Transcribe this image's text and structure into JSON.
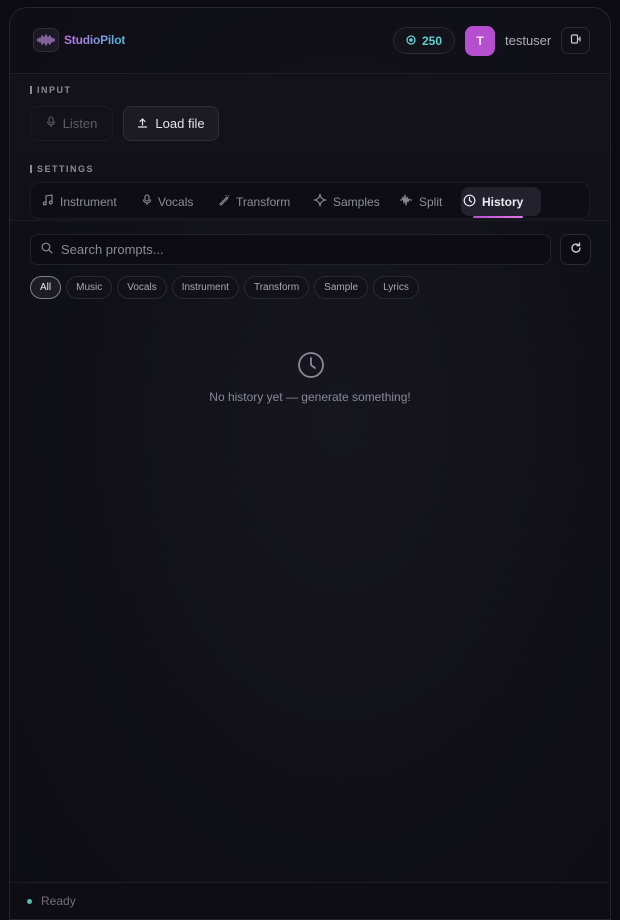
{
  "header": {
    "brand": "StudioPilot",
    "credits": "250",
    "avatar_initial": "T",
    "username": "testuser"
  },
  "input_section": {
    "label": "INPUT",
    "listen_label": "Listen",
    "load_file_label": "Load file"
  },
  "settings_section": {
    "label": "SETTINGS",
    "tabs": [
      {
        "label": "Instrument",
        "icon": "music-note-icon"
      },
      {
        "label": "Vocals",
        "icon": "microphone-icon"
      },
      {
        "label": "Transform",
        "icon": "wand-icon"
      },
      {
        "label": "Samples",
        "icon": "sparkle-icon"
      },
      {
        "label": "Split",
        "icon": "waveform-icon"
      },
      {
        "label": "History",
        "icon": "clock-icon",
        "active": true
      }
    ]
  },
  "history": {
    "search_placeholder": "Search prompts...",
    "filters": [
      "All",
      "Music",
      "Vocals",
      "Instrument",
      "Transform",
      "Sample",
      "Lyrics"
    ],
    "active_filter": "All",
    "empty_message": "No history yet — generate something!"
  },
  "status": {
    "text": "Ready",
    "color": "#4fc0b0"
  },
  "colors": {
    "accent": "#b54fd0",
    "credits": "#5fd0d0",
    "background": "#0c0b12"
  }
}
